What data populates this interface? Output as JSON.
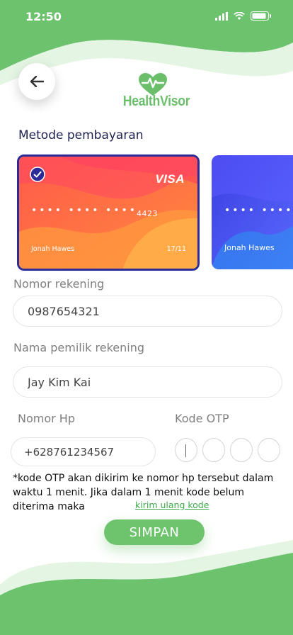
{
  "status_bar": {
    "time": "12:50"
  },
  "header": {
    "logo_text": "HealthVisor"
  },
  "payment": {
    "section_title": "Metode pembayaran",
    "cards": [
      {
        "brand": "VISA",
        "masked": "•••• •••• ••••",
        "last4": "4423",
        "holder": "Jonah Hawes",
        "expiry": "17/11",
        "selected": true
      },
      {
        "masked": "•••• ••••",
        "holder": "Jonah Hawes",
        "selected": false
      }
    ]
  },
  "form": {
    "account_number": {
      "label": "Nomor rekening",
      "value": "0987654321"
    },
    "account_name": {
      "label": "Nama pemilik rekening",
      "value": "Jay Kim Kai"
    },
    "phone": {
      "label": "Nomor Hp",
      "value": "+628761234567"
    },
    "otp": {
      "label": "Kode OTP"
    }
  },
  "note": {
    "text": "*kode OTP akan dikirim ke nomor hp tersebut dalam waktu 1 menit. Jika dalam 1 menit kode belum diterima maka",
    "link": "kirim ulang kode"
  },
  "actions": {
    "save_label": "SIMPAN"
  },
  "colors": {
    "primary_green": "#6bbf6b",
    "card_border": "#2b2c98",
    "title_navy": "#1e2050"
  }
}
